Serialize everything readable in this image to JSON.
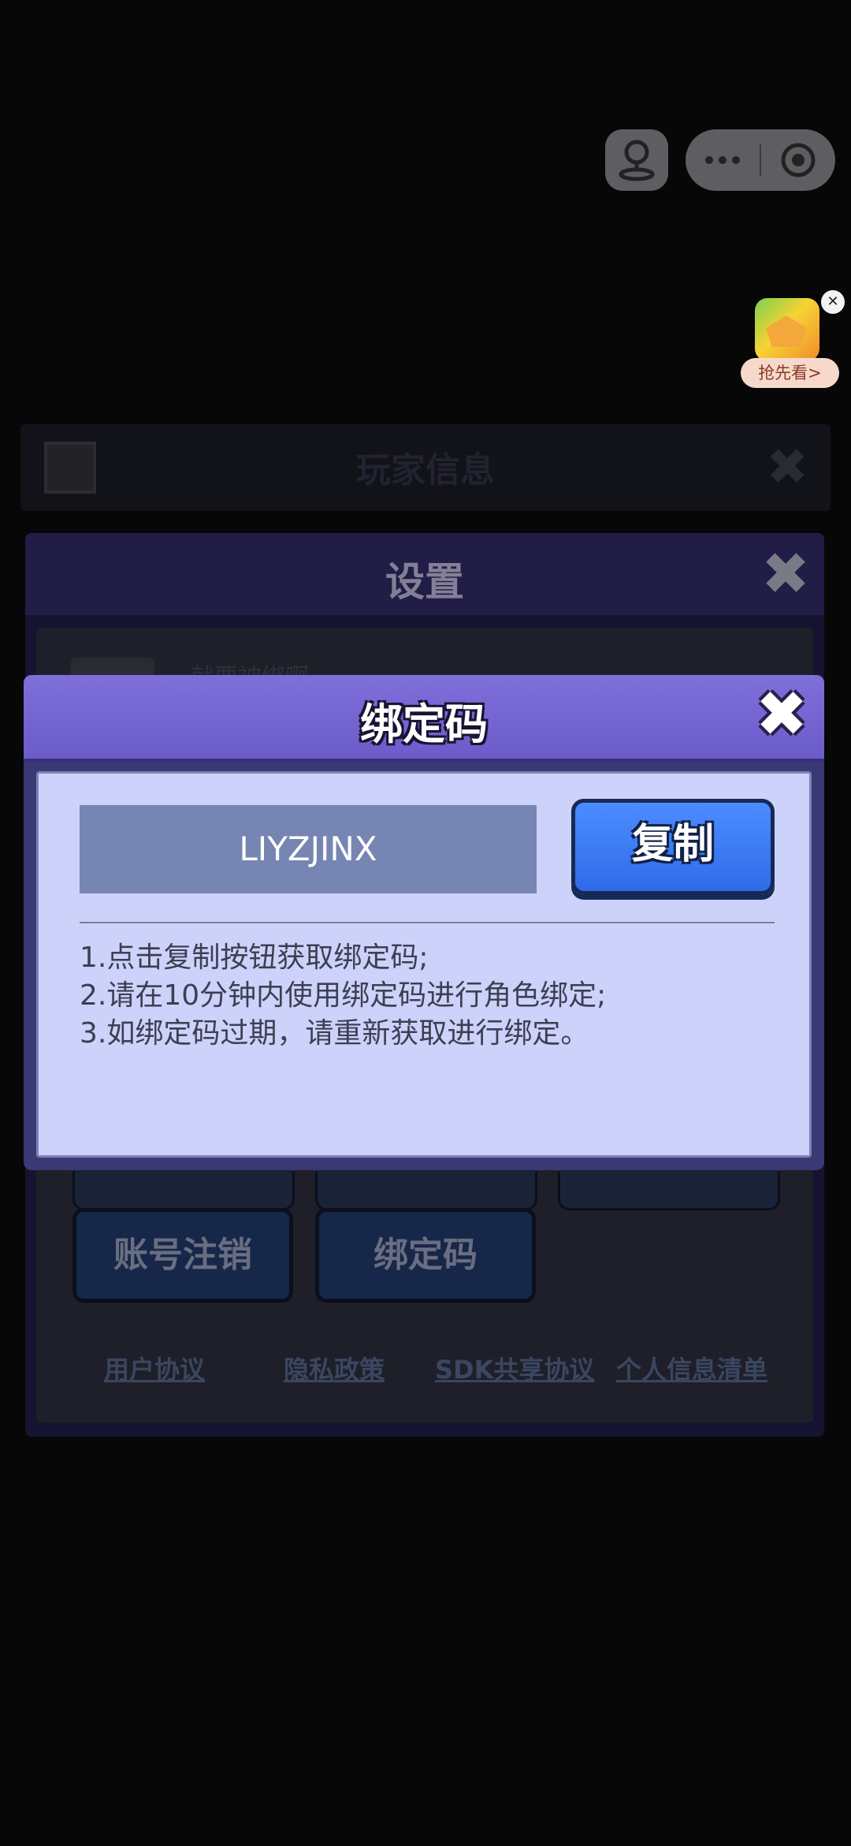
{
  "background_dialogs": {
    "player_info": {
      "title": "玩家信息"
    },
    "settings": {
      "title": "设置",
      "first_item_text": "就要被绑啊",
      "buttons": [
        "账号注销",
        "绑定码"
      ],
      "links": [
        "用户协议",
        "隐私政策",
        "SDK共享协议",
        "个人信息清单"
      ]
    }
  },
  "ad": {
    "label": "抢先看>",
    "close_icon": "close-icon"
  },
  "bind_dialog": {
    "title": "绑定码",
    "code": "LIYZJINX",
    "copy_label": "复制",
    "instructions": [
      "1.点击复制按钮获取绑定码;",
      "2.请在10分钟内使用绑定码进行角色绑定;",
      "3.如绑定码过期，请重新获取进行绑定。"
    ]
  },
  "colors": {
    "header_purple": "#7264d3",
    "body_lavender": "#cdd2fb",
    "copy_blue": "#3b7bf5",
    "code_box": "#7785b3"
  }
}
